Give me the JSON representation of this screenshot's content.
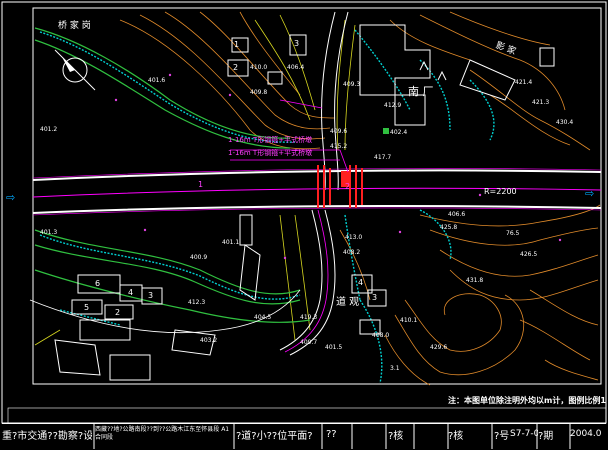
{
  "labels": {
    "top_road": "桥 家 岗",
    "factory": "南 厂",
    "shadow_place": "影  家",
    "map_note": "注：本图单位除注明外均以m计，图例比例1",
    "radius": "R=2200",
    "arrow_left": "⇨",
    "arrow_right": "⇨",
    "pier_note_1": "1-16m T形钢箍+平式桥墩",
    "pier_note_2": "1-16m T形钢箍+平式桥墩",
    "building_label_1": "1",
    "building_label_2": "2",
    "building_label_3": "3",
    "building_label_4": "4",
    "building_label_5": "5",
    "building_label_6": "6",
    "building_label_3_2": "3",
    "building_label_2_2": "2",
    "bldg_4_south": "4",
    "bldg_3_south": "3",
    "dao_label": "道 观",
    "station_1": "1",
    "station_2": "2",
    "elev": [
      "401.6",
      "401.2",
      "401.3",
      "400.9",
      "401.1",
      "409.3",
      "406.4",
      "409.6",
      "415.2",
      "417.7",
      "425.8",
      "406.6",
      "430.4",
      "421.3",
      "421.4",
      "408.0",
      "419.3",
      "409.7",
      "412.3",
      "410.0",
      "409.8",
      "401.5",
      "403.2",
      "413.0",
      "408.2",
      "402.4",
      "412.9",
      "76.5",
      "431.8",
      "426.5",
      "429.6",
      "410.1",
      "404.5",
      "3.1"
    ]
  },
  "title_block": {
    "cell_1": "重?市交通??勘察?设计院",
    "cell_2": "西藏??地?公路南段??到??公路木江东至怀县段 A1合同段",
    "cell_3": "?道?小??位平面?",
    "cell_4": "??",
    "cell_5": "?核",
    "cell_6": "?核",
    "cell_7": "?号",
    "cell_8": "S7-7-0",
    "cell_9": "?期",
    "cell_10": "2004.0"
  },
  "colors": {
    "frame": "#ffffff",
    "road_edge": "#ffffff",
    "center_line": "#ff00ff",
    "contour_orange": "#e08a2a",
    "contour_yellow": "#d8d820",
    "contour_green": "#30c040",
    "slope_cyan": "#00d0d0",
    "bridge_red": "#ff2020",
    "text_magenta": "#e040e0",
    "text_white": "#ffffff",
    "text_yellow": "#ffff40"
  }
}
